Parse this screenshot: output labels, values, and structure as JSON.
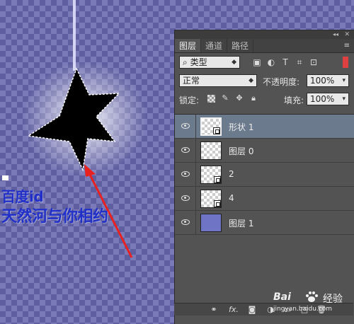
{
  "canvas": {
    "annotation_line1": "百度id",
    "annotation_line2": "天然河与你相约",
    "annotation_color": "#2030c8",
    "arrow_color": "#e82020"
  },
  "panel": {
    "tabs": [
      {
        "label": "图层",
        "active": true
      },
      {
        "label": "通道",
        "active": false
      },
      {
        "label": "路径",
        "active": false
      }
    ],
    "filter": {
      "kind_label": "类型",
      "icons": [
        "image-filter-icon",
        "adjustment-filter-icon",
        "type-filter-icon",
        "shape-filter-icon",
        "smart-object-filter-icon"
      ]
    },
    "blend_mode": "正常",
    "opacity_label": "不透明度:",
    "opacity_value": "100%",
    "lock_label": "锁定:",
    "fill_label": "填充:",
    "fill_value": "100%",
    "layers": [
      {
        "name": "形状 1",
        "selected": true,
        "thumb": "shape"
      },
      {
        "name": "图层 0",
        "selected": false,
        "thumb": "transparent"
      },
      {
        "name": "2",
        "selected": false,
        "thumb": "smart"
      },
      {
        "name": "4",
        "selected": false,
        "thumb": "smart"
      },
      {
        "name": "图层 1",
        "selected": false,
        "thumb": "solid"
      }
    ]
  },
  "watermark": {
    "brand": "Bai",
    "brand_suffix": "经验",
    "url": "jingyan.baidu.com"
  }
}
